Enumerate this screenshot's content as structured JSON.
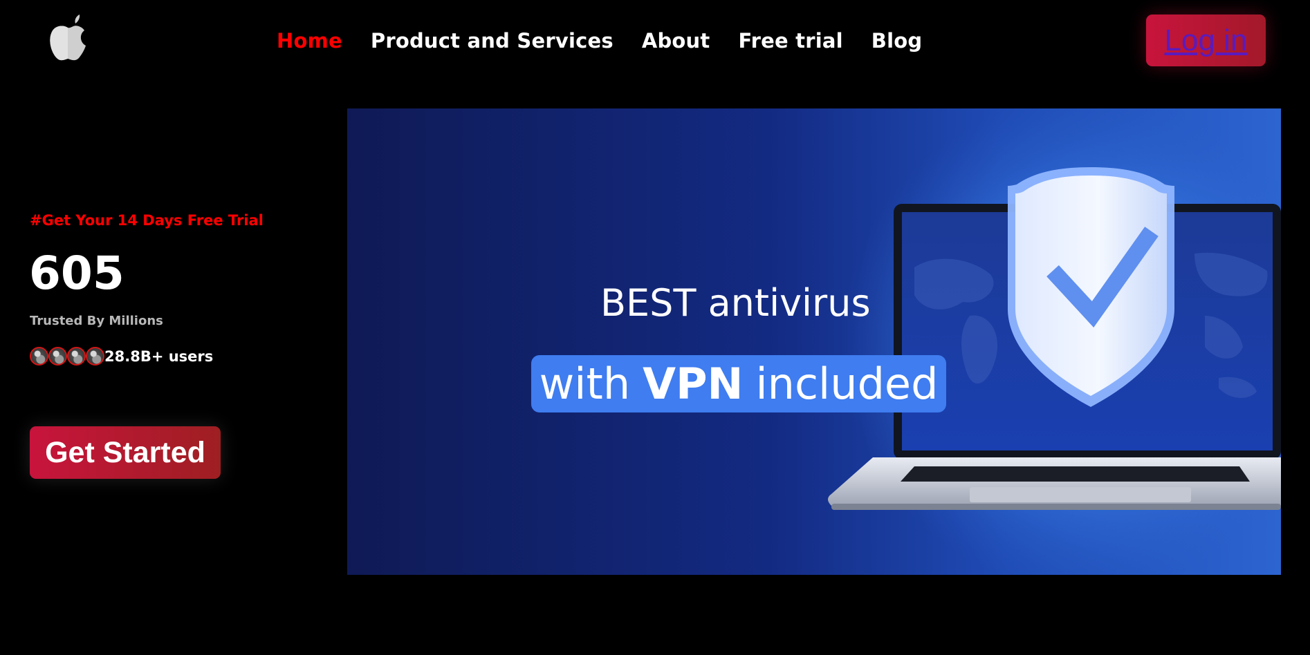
{
  "header": {
    "logo_icon": "apple-icon",
    "nav": [
      {
        "label": "Home",
        "active": true
      },
      {
        "label": "Product and Services",
        "active": false
      },
      {
        "label": "About",
        "active": false
      },
      {
        "label": "Free trial",
        "active": false
      },
      {
        "label": "Blog",
        "active": false
      }
    ],
    "login_label": "Log in"
  },
  "hero": {
    "trial_tag": "#Get Your 14 Days Free Trial",
    "count": "605",
    "trusted": "Trusted By Millions",
    "users_text": "28.8B+ users",
    "cta_label": "Get Started",
    "banner": {
      "line1": "BEST antivirus",
      "line2_pre": "with",
      "line2_bold": "VPN",
      "line2_post": "included"
    }
  },
  "colors": {
    "background": "#000000",
    "accent_red": "#ff0000",
    "button_gradient_start": "#c8143c",
    "button_gradient_end": "#9e1f22",
    "login_link": "#5a1bbd",
    "banner_pill": "#3f7df0"
  }
}
